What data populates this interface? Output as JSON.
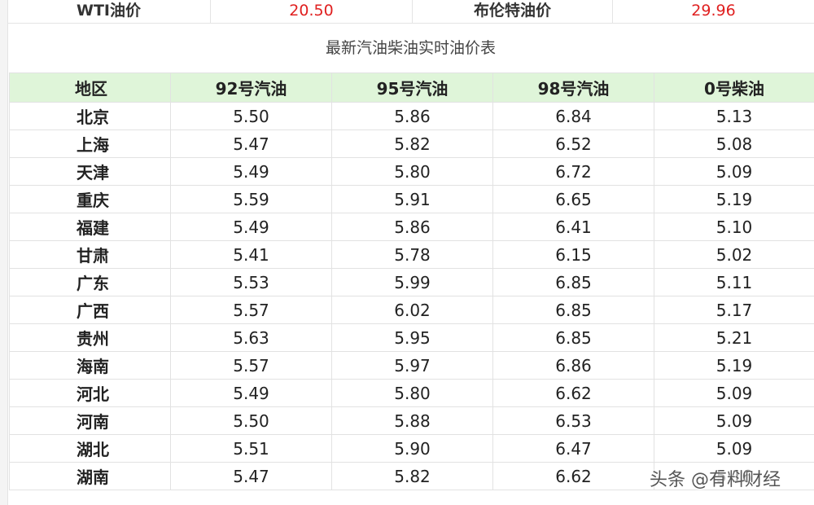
{
  "crude": {
    "wti_label": "WTI油价",
    "wti_value": "20.50",
    "brent_label": "布伦特油价",
    "brent_value": "29.96"
  },
  "table_title": "最新汽油柴油实时油价表",
  "headers": [
    "地区",
    "92号汽油",
    "95号汽油",
    "98号汽油",
    "0号柴油"
  ],
  "rows": [
    [
      "北京",
      "5.50",
      "5.86",
      "6.84",
      "5.13"
    ],
    [
      "上海",
      "5.47",
      "5.82",
      "6.52",
      "5.08"
    ],
    [
      "天津",
      "5.49",
      "5.80",
      "6.72",
      "5.09"
    ],
    [
      "重庆",
      "5.59",
      "5.91",
      "6.65",
      "5.19"
    ],
    [
      "福建",
      "5.49",
      "5.86",
      "6.41",
      "5.10"
    ],
    [
      "甘肃",
      "5.41",
      "5.78",
      "6.15",
      "5.02"
    ],
    [
      "广东",
      "5.53",
      "5.99",
      "6.85",
      "5.11"
    ],
    [
      "广西",
      "5.57",
      "6.02",
      "6.85",
      "5.17"
    ],
    [
      "贵州",
      "5.63",
      "5.95",
      "6.85",
      "5.21"
    ],
    [
      "海南",
      "5.57",
      "5.97",
      "6.86",
      "5.19"
    ],
    [
      "河北",
      "5.49",
      "5.80",
      "6.62",
      "5.09"
    ],
    [
      "河南",
      "5.50",
      "5.88",
      "6.53",
      "5.09"
    ],
    [
      "湖北",
      "5.51",
      "5.90",
      "6.47",
      "5.09"
    ],
    [
      "湖南",
      "5.47",
      "5.82",
      "6.62",
      "5.16"
    ]
  ],
  "watermark": "头条 @有料财经",
  "colors": {
    "header_bg": "#dff5d9",
    "crude_value": "#e02020"
  }
}
